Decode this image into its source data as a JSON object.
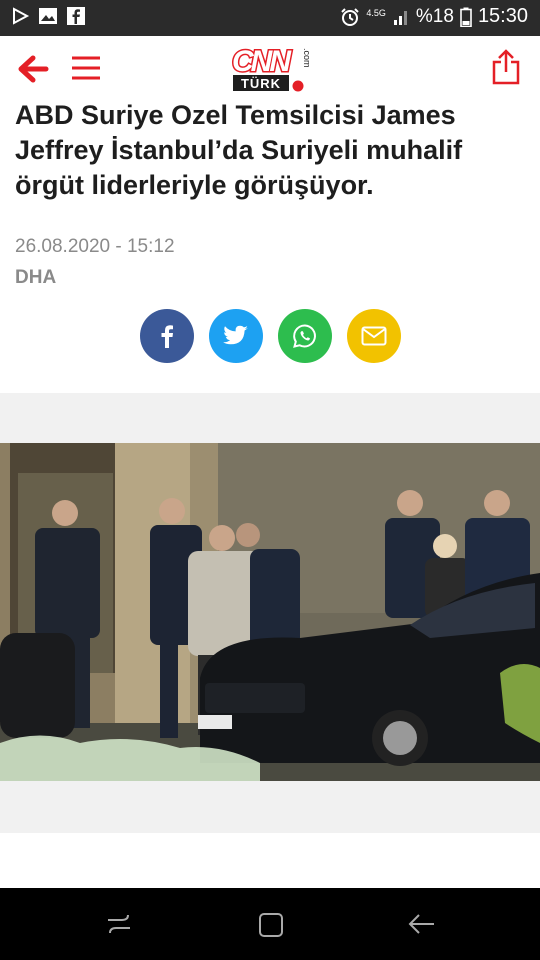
{
  "status_bar": {
    "time": "15:30",
    "battery_percent": "%18",
    "network": "4.5G",
    "icons": [
      "play-icon",
      "gallery-icon",
      "facebook-icon",
      "alarm-icon",
      "signal-icon",
      "battery-icon"
    ]
  },
  "header": {
    "logo_text": "CNN",
    "logo_sub": "TÜRK",
    "logo_com": ".com",
    "accent_color": "#e41f26"
  },
  "article": {
    "headline": "ABD Suriye Ozel Temsilcisi James Jeffrey İstanbul’da Suriyeli muhalif örgüt liderleriyle görüşüyor.",
    "date": "26.08.2020 - 15:12",
    "source": "DHA"
  },
  "share_buttons": [
    {
      "name": "facebook",
      "color": "#3b5998"
    },
    {
      "name": "twitter",
      "color": "#1da1f2"
    },
    {
      "name": "whatsapp",
      "color": "#2dbd4e"
    },
    {
      "name": "email",
      "color": "#f2c200"
    }
  ],
  "nav_bar": {
    "icons": [
      "recent-apps-icon",
      "home-icon",
      "back-icon"
    ]
  }
}
